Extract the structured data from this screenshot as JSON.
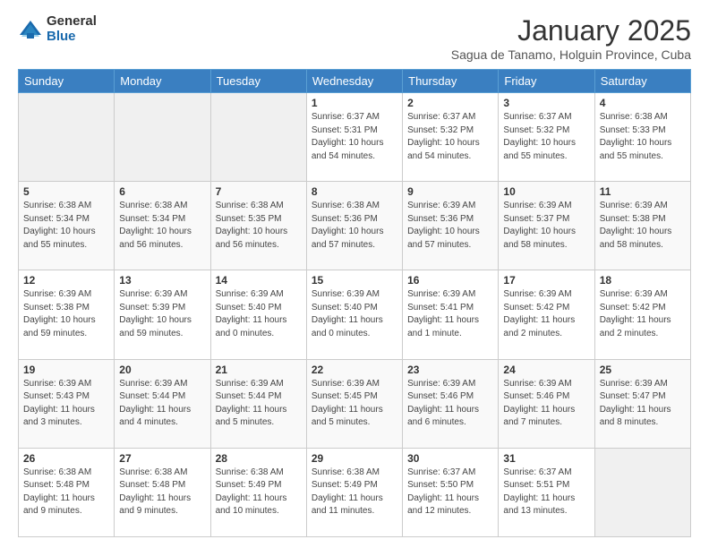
{
  "header": {
    "logo_general": "General",
    "logo_blue": "Blue",
    "month": "January 2025",
    "location": "Sagua de Tanamo, Holguin Province, Cuba"
  },
  "days_of_week": [
    "Sunday",
    "Monday",
    "Tuesday",
    "Wednesday",
    "Thursday",
    "Friday",
    "Saturday"
  ],
  "weeks": [
    [
      {
        "day": "",
        "info": ""
      },
      {
        "day": "",
        "info": ""
      },
      {
        "day": "",
        "info": ""
      },
      {
        "day": "1",
        "info": "Sunrise: 6:37 AM\nSunset: 5:31 PM\nDaylight: 10 hours\nand 54 minutes."
      },
      {
        "day": "2",
        "info": "Sunrise: 6:37 AM\nSunset: 5:32 PM\nDaylight: 10 hours\nand 54 minutes."
      },
      {
        "day": "3",
        "info": "Sunrise: 6:37 AM\nSunset: 5:32 PM\nDaylight: 10 hours\nand 55 minutes."
      },
      {
        "day": "4",
        "info": "Sunrise: 6:38 AM\nSunset: 5:33 PM\nDaylight: 10 hours\nand 55 minutes."
      }
    ],
    [
      {
        "day": "5",
        "info": "Sunrise: 6:38 AM\nSunset: 5:34 PM\nDaylight: 10 hours\nand 55 minutes."
      },
      {
        "day": "6",
        "info": "Sunrise: 6:38 AM\nSunset: 5:34 PM\nDaylight: 10 hours\nand 56 minutes."
      },
      {
        "day": "7",
        "info": "Sunrise: 6:38 AM\nSunset: 5:35 PM\nDaylight: 10 hours\nand 56 minutes."
      },
      {
        "day": "8",
        "info": "Sunrise: 6:38 AM\nSunset: 5:36 PM\nDaylight: 10 hours\nand 57 minutes."
      },
      {
        "day": "9",
        "info": "Sunrise: 6:39 AM\nSunset: 5:36 PM\nDaylight: 10 hours\nand 57 minutes."
      },
      {
        "day": "10",
        "info": "Sunrise: 6:39 AM\nSunset: 5:37 PM\nDaylight: 10 hours\nand 58 minutes."
      },
      {
        "day": "11",
        "info": "Sunrise: 6:39 AM\nSunset: 5:38 PM\nDaylight: 10 hours\nand 58 minutes."
      }
    ],
    [
      {
        "day": "12",
        "info": "Sunrise: 6:39 AM\nSunset: 5:38 PM\nDaylight: 10 hours\nand 59 minutes."
      },
      {
        "day": "13",
        "info": "Sunrise: 6:39 AM\nSunset: 5:39 PM\nDaylight: 10 hours\nand 59 minutes."
      },
      {
        "day": "14",
        "info": "Sunrise: 6:39 AM\nSunset: 5:40 PM\nDaylight: 11 hours\nand 0 minutes."
      },
      {
        "day": "15",
        "info": "Sunrise: 6:39 AM\nSunset: 5:40 PM\nDaylight: 11 hours\nand 0 minutes."
      },
      {
        "day": "16",
        "info": "Sunrise: 6:39 AM\nSunset: 5:41 PM\nDaylight: 11 hours\nand 1 minute."
      },
      {
        "day": "17",
        "info": "Sunrise: 6:39 AM\nSunset: 5:42 PM\nDaylight: 11 hours\nand 2 minutes."
      },
      {
        "day": "18",
        "info": "Sunrise: 6:39 AM\nSunset: 5:42 PM\nDaylight: 11 hours\nand 2 minutes."
      }
    ],
    [
      {
        "day": "19",
        "info": "Sunrise: 6:39 AM\nSunset: 5:43 PM\nDaylight: 11 hours\nand 3 minutes."
      },
      {
        "day": "20",
        "info": "Sunrise: 6:39 AM\nSunset: 5:44 PM\nDaylight: 11 hours\nand 4 minutes."
      },
      {
        "day": "21",
        "info": "Sunrise: 6:39 AM\nSunset: 5:44 PM\nDaylight: 11 hours\nand 5 minutes."
      },
      {
        "day": "22",
        "info": "Sunrise: 6:39 AM\nSunset: 5:45 PM\nDaylight: 11 hours\nand 5 minutes."
      },
      {
        "day": "23",
        "info": "Sunrise: 6:39 AM\nSunset: 5:46 PM\nDaylight: 11 hours\nand 6 minutes."
      },
      {
        "day": "24",
        "info": "Sunrise: 6:39 AM\nSunset: 5:46 PM\nDaylight: 11 hours\nand 7 minutes."
      },
      {
        "day": "25",
        "info": "Sunrise: 6:39 AM\nSunset: 5:47 PM\nDaylight: 11 hours\nand 8 minutes."
      }
    ],
    [
      {
        "day": "26",
        "info": "Sunrise: 6:38 AM\nSunset: 5:48 PM\nDaylight: 11 hours\nand 9 minutes."
      },
      {
        "day": "27",
        "info": "Sunrise: 6:38 AM\nSunset: 5:48 PM\nDaylight: 11 hours\nand 9 minutes."
      },
      {
        "day": "28",
        "info": "Sunrise: 6:38 AM\nSunset: 5:49 PM\nDaylight: 11 hours\nand 10 minutes."
      },
      {
        "day": "29",
        "info": "Sunrise: 6:38 AM\nSunset: 5:49 PM\nDaylight: 11 hours\nand 11 minutes."
      },
      {
        "day": "30",
        "info": "Sunrise: 6:37 AM\nSunset: 5:50 PM\nDaylight: 11 hours\nand 12 minutes."
      },
      {
        "day": "31",
        "info": "Sunrise: 6:37 AM\nSunset: 5:51 PM\nDaylight: 11 hours\nand 13 minutes."
      },
      {
        "day": "",
        "info": ""
      }
    ]
  ]
}
